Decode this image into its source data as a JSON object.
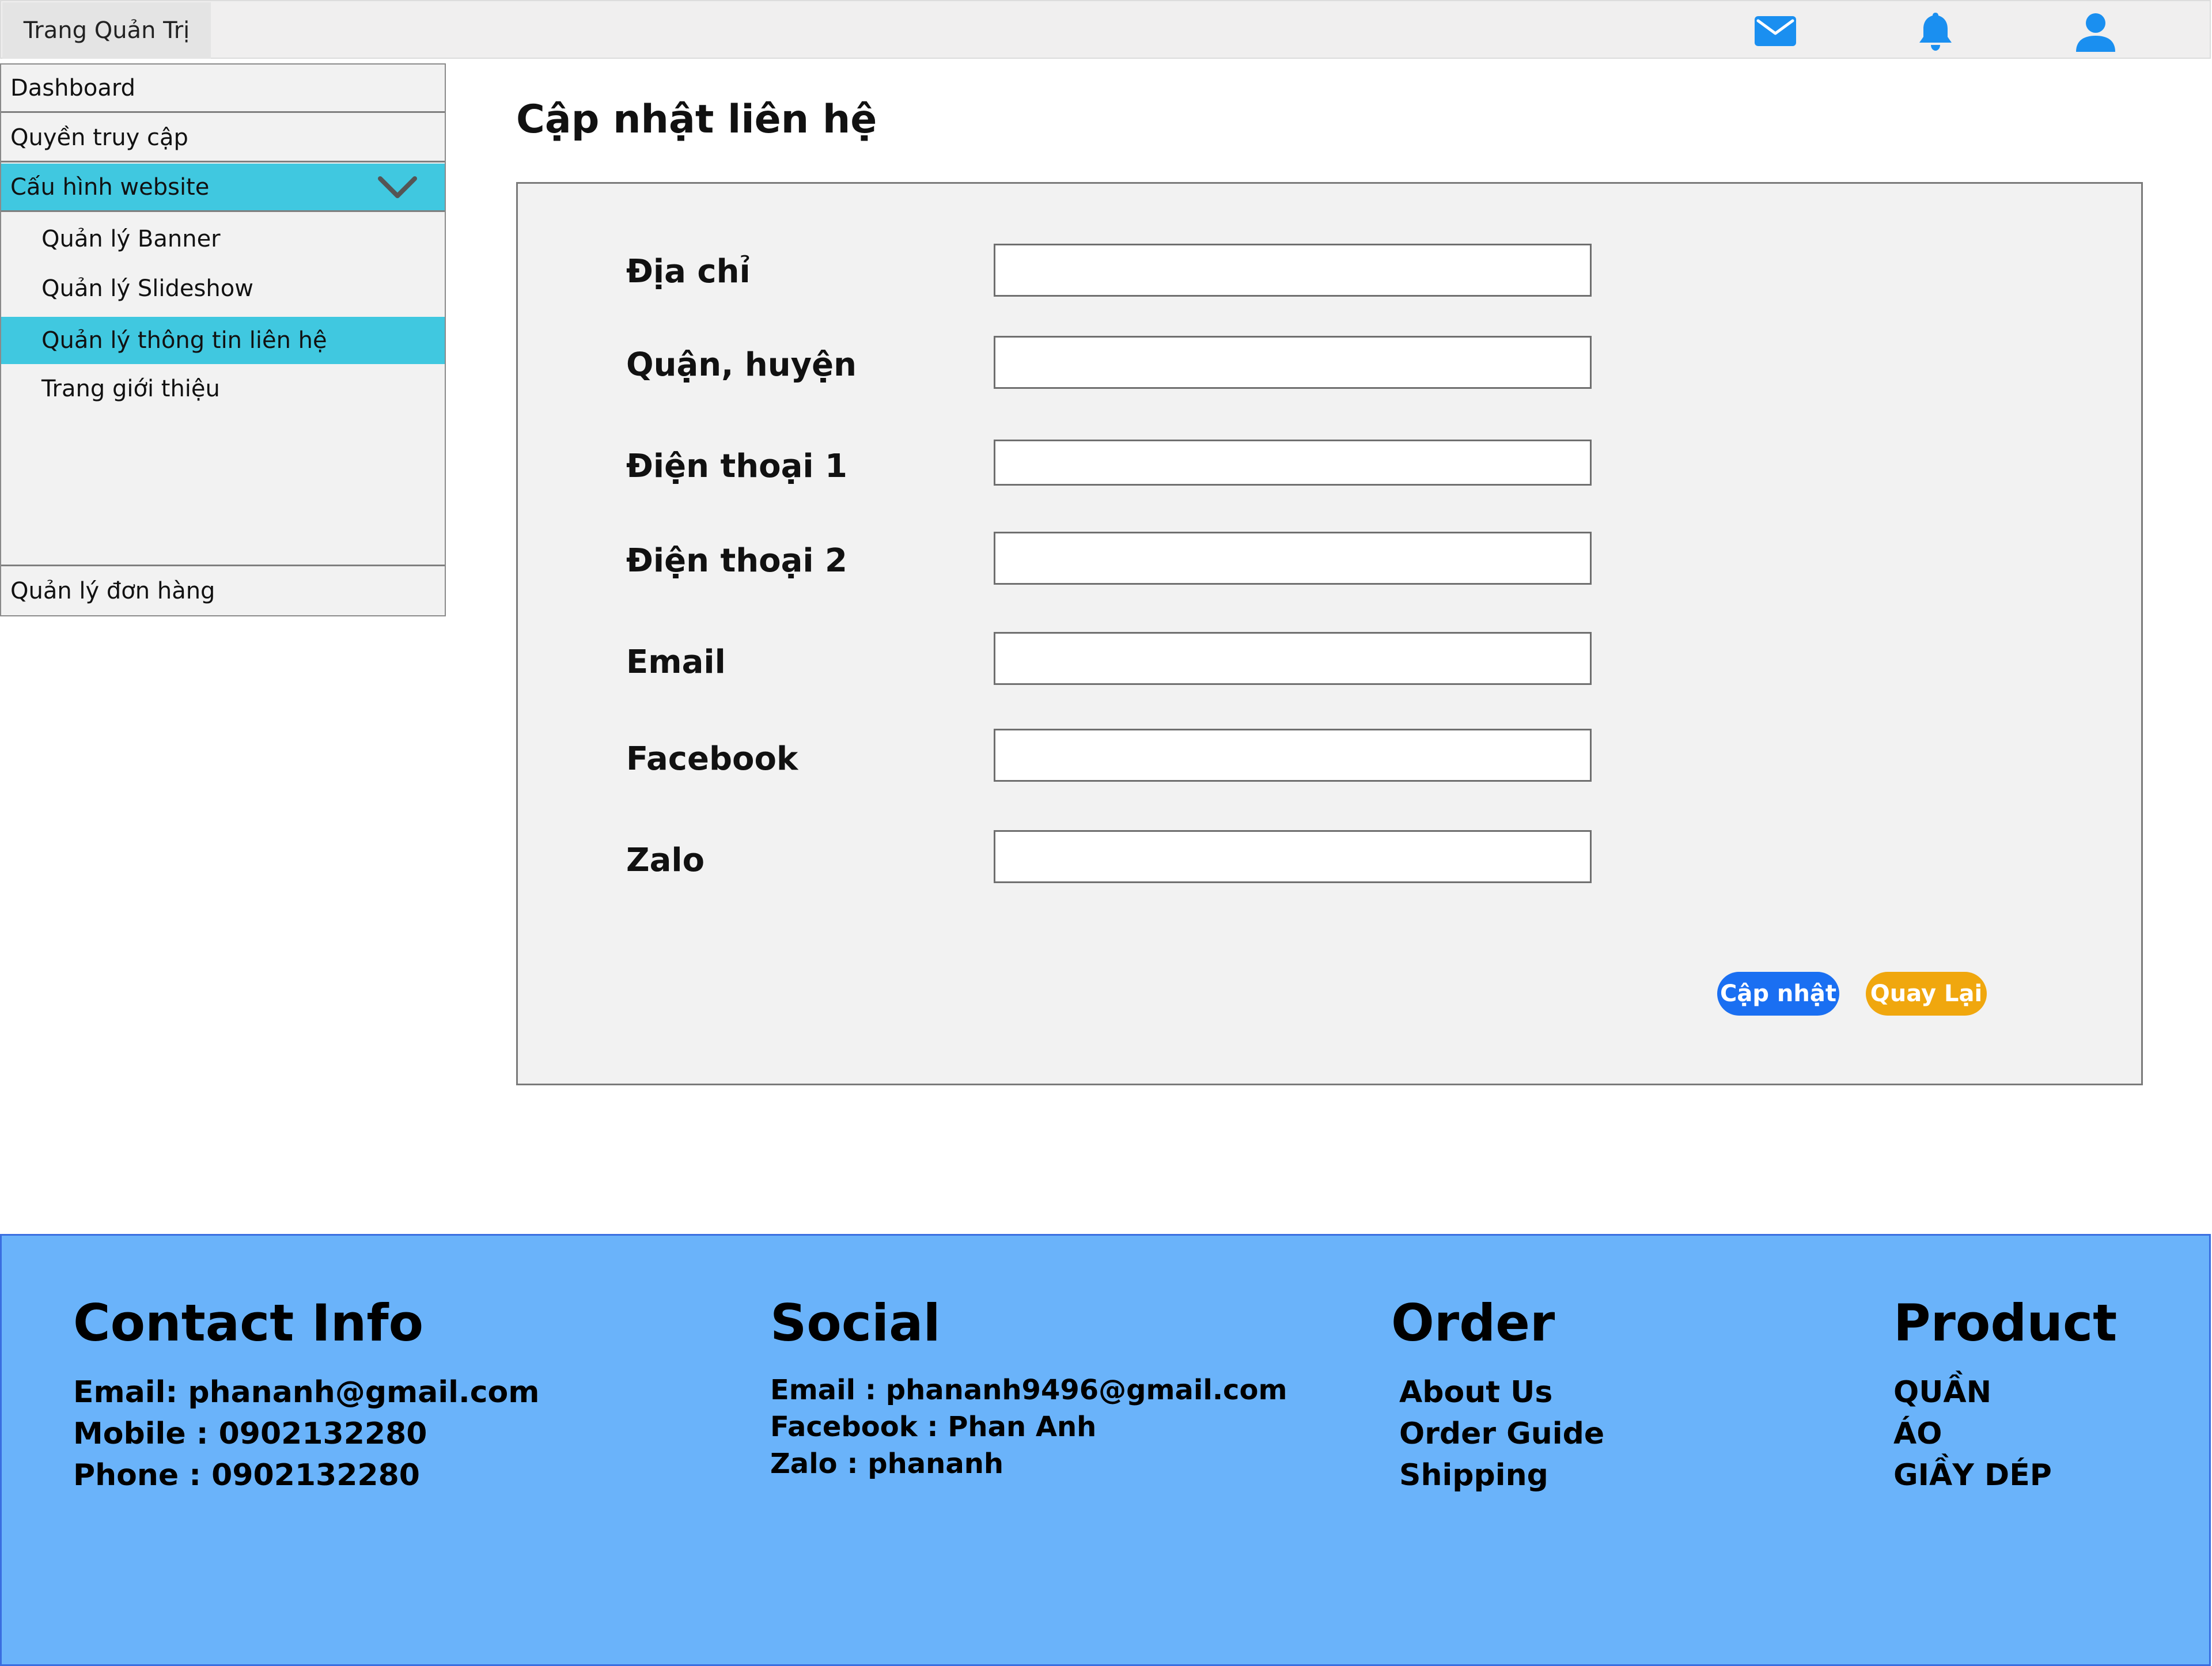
{
  "header": {
    "brand": "Trang Quản Trị",
    "icons": [
      "mail-icon",
      "bell-icon",
      "user-icon"
    ],
    "icon_color": "#1a8ff0"
  },
  "sidebar": {
    "items": [
      {
        "label": "Dashboard"
      },
      {
        "label": "Quyền truy cập"
      },
      {
        "label": "Cấu hình website",
        "expanded": true
      },
      {
        "label": "Quản lý đơn hàng"
      }
    ],
    "subitems": [
      {
        "label": "Quản lý Banner"
      },
      {
        "label": "Quản lý Slideshow"
      },
      {
        "label": "Quản lý thông tin liên hệ",
        "active": true
      },
      {
        "label": "Trang giới thiệu"
      }
    ],
    "active_color": "#40c8e0"
  },
  "main": {
    "title": "Cập nhật liên hệ",
    "fields": [
      {
        "label": "Địa chỉ",
        "value": ""
      },
      {
        "label": "Quận, huyện",
        "value": ""
      },
      {
        "label": "Điện thoại 1",
        "value": ""
      },
      {
        "label": "Điện thoại 2",
        "value": ""
      },
      {
        "label": "Email",
        "value": ""
      },
      {
        "label": "Facebook",
        "value": ""
      },
      {
        "label": "Zalo",
        "value": ""
      }
    ],
    "update_label": "Cập nhật",
    "back_label": "Quay Lại",
    "update_color": "#1a6ff2",
    "back_color": "#f0a70e"
  },
  "footer": {
    "background": "#6ab3fa",
    "contact": {
      "heading": "Contact Info",
      "lines": [
        "Email: phananh@gmail.com",
        "Mobile : 0902132280",
        "Phone : 0902132280"
      ]
    },
    "social": {
      "heading": "Social",
      "lines": [
        "Email : phananh9496@gmail.com",
        "Facebook : Phan Anh",
        "Zalo : phananh"
      ]
    },
    "order": {
      "heading": "Order",
      "lines": [
        "About Us",
        "Order Guide",
        "Shipping"
      ]
    },
    "product": {
      "heading": "Product",
      "lines": [
        "QUẦN",
        "ÁO",
        "GIẦY DÉP"
      ]
    }
  }
}
